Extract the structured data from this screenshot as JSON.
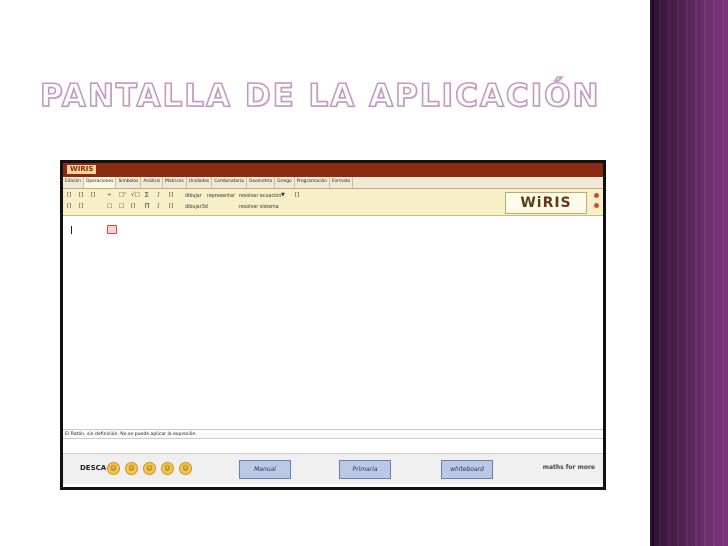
{
  "slide": {
    "title": "PANTALLA DE LA APLICACIÓN"
  },
  "app": {
    "logo": "WIRIS",
    "tabs": [
      "Edición",
      "Operaciones",
      "Símbolos",
      "Análisis",
      "Matrices",
      "Unidades",
      "Combinatoria",
      "Geometría",
      "Griego",
      "Programación",
      "Formato"
    ],
    "active_tab": "Operaciones",
    "toolbar": {
      "row1_symbols": [
        "[]",
        "[]",
        "[]",
        "÷",
        "□ⁿ",
        "√□",
        "∑",
        "∫",
        "[]"
      ],
      "row2_symbols": [
        "[]",
        "[]",
        "□",
        "□",
        "[]",
        "∏",
        "∫",
        "[]"
      ],
      "row1_links": [
        "dibujar",
        "representar",
        "resolver ecuación"
      ],
      "row2_links": [
        "dibujar3d",
        "resolver sistema"
      ],
      "dropdown_icon": "triangle-down-icon",
      "brand": "WiRIS"
    },
    "message": "El Ratón, sin definición. No se puede aplicar la expresión.",
    "bottom": {
      "label": "DESCA",
      "smiley_icons": [
        "smiley-icon-1",
        "smiley-icon-2",
        "smiley-icon-3",
        "smiley-icon-4",
        "smiley-icon-5"
      ],
      "buttons": [
        "Manual",
        "Primaria",
        "whiteboard"
      ],
      "brand": "maths for more"
    }
  }
}
